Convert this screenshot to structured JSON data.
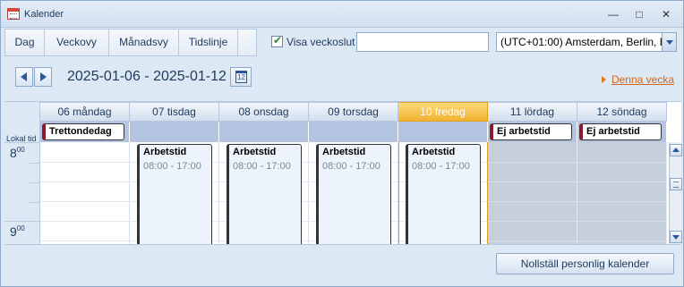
{
  "window": {
    "title": "Kalender",
    "minimize_glyph": "—",
    "maximize_glyph": "□",
    "close_glyph": "✕"
  },
  "toolbar": {
    "tabs": [
      {
        "label": "Dag"
      },
      {
        "label": "Veckovy"
      },
      {
        "label": "Månadsvy"
      },
      {
        "label": "Tidslinje"
      },
      {
        "label": ""
      }
    ],
    "show_week_end_label": "Visa veckoslut",
    "show_week_end_checked": true,
    "search_value": "",
    "timezone": "(UTC+01:00) Amsterdam, Berlin, B"
  },
  "nav": {
    "date_range": "2025-01-06 - 2025-01-12",
    "calendar_icon_day": "12",
    "this_week_link": "Denna vecka"
  },
  "grid": {
    "local_time_label": "Lokal tid",
    "hours": [
      {
        "h": "8",
        "m": "00"
      },
      {
        "h": "9",
        "m": "00"
      }
    ],
    "days": [
      {
        "header": "06 måndag",
        "allday": "Trettondedag",
        "event_title": "",
        "event_time": "",
        "off": false,
        "today": false
      },
      {
        "header": "07 tisdag",
        "allday": "",
        "event_title": "Arbetstid",
        "event_time": "08:00 - 17:00",
        "off": false,
        "today": false
      },
      {
        "header": "08 onsdag",
        "allday": "",
        "event_title": "Arbetstid",
        "event_time": "08:00 - 17:00",
        "off": false,
        "today": false
      },
      {
        "header": "09 torsdag",
        "allday": "",
        "event_title": "Arbetstid",
        "event_time": "08:00 - 17:00",
        "off": false,
        "today": false
      },
      {
        "header": "10 fredag",
        "allday": "",
        "event_title": "Arbetstid",
        "event_time": "08:00 - 17:00",
        "off": false,
        "today": true
      },
      {
        "header": "11 lördag",
        "allday": "Ej arbetstid",
        "event_title": "",
        "event_time": "",
        "off": true,
        "today": false
      },
      {
        "header": "12 söndag",
        "allday": "Ej arbetstid",
        "event_title": "",
        "event_time": "",
        "off": true,
        "today": false
      }
    ]
  },
  "footer": {
    "reset_button": "Nollställ personlig kalender"
  },
  "colors": {
    "accent": "#1e395b",
    "today": "#f2b232",
    "link": "#d2661a",
    "event_border": "#8b1a2a"
  }
}
